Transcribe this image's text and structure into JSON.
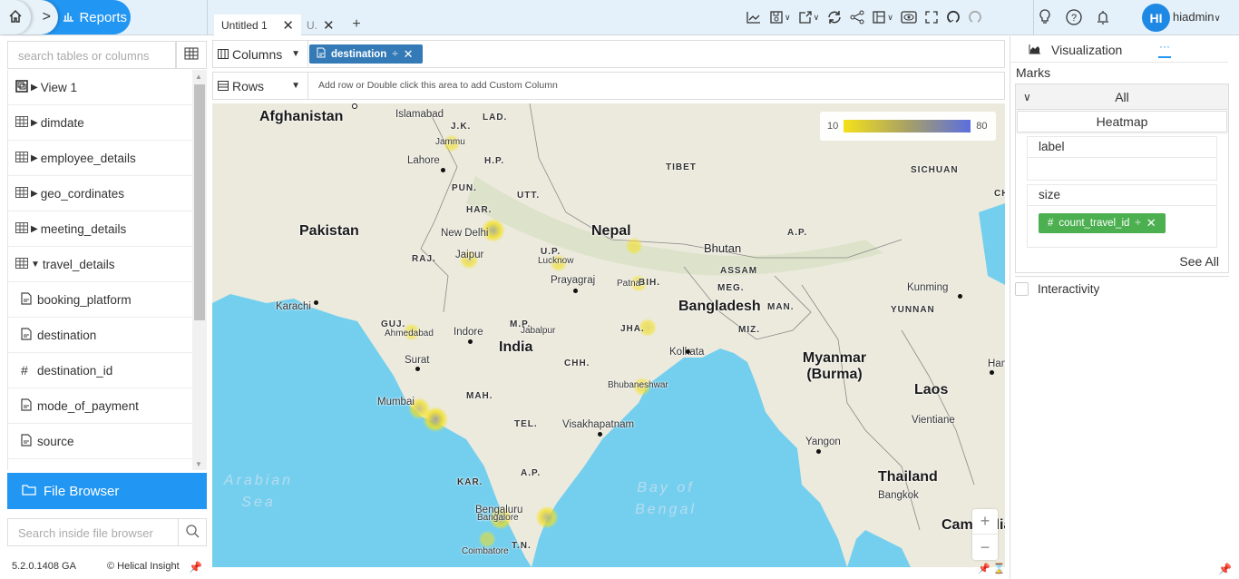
{
  "nav": {
    "reports_label": "Reports"
  },
  "tabs": [
    {
      "label": "Untitled 1"
    },
    {
      "label": "U."
    }
  ],
  "toolbar": {
    "icons": [
      "line-chart-icon",
      "save-icon",
      "export-icon",
      "refresh-icon",
      "share-icon",
      "layout-icon",
      "preview-icon",
      "fullscreen-icon",
      "undo-icon",
      "redo-icon"
    ]
  },
  "user": {
    "initials": "HI",
    "name": "hiadmin"
  },
  "sidebar": {
    "search_placeholder": "search tables or columns",
    "tables": [
      {
        "label": "View 1",
        "type": "view",
        "expanded": false
      },
      {
        "label": "dimdate",
        "type": "table",
        "expanded": false
      },
      {
        "label": "employee_details",
        "type": "table",
        "expanded": false
      },
      {
        "label": "geo_cordinates",
        "type": "table",
        "expanded": false
      },
      {
        "label": "meeting_details",
        "type": "table",
        "expanded": false
      },
      {
        "label": "travel_details",
        "type": "table",
        "expanded": true
      }
    ],
    "columns": [
      {
        "label": "booking_platform",
        "type": "text"
      },
      {
        "label": "destination",
        "type": "text"
      },
      {
        "label": "destination_id",
        "type": "number"
      },
      {
        "label": "mode_of_payment",
        "type": "text"
      },
      {
        "label": "source",
        "type": "text"
      }
    ],
    "file_browser_label": "File Browser",
    "file_search_placeholder": "Search inside file browser",
    "version": "5.2.0.1408 GA",
    "copyright": "Helical Insight"
  },
  "shelves": {
    "columns_label": "Columns",
    "columns_pill": "destination",
    "rows_label": "Rows",
    "rows_hint": "Add row or Double click this area to add Custom Column"
  },
  "map": {
    "legend_min": "10",
    "legend_max": "80",
    "legend_colors": {
      "low": "#f4e11a",
      "high": "#5b6ee0"
    },
    "countries": [
      "Afghanistan",
      "Pakistan",
      "India",
      "Nepal",
      "Bhutan",
      "Bangladesh",
      "Myanmar (Burma)",
      "Laos",
      "Thailand",
      "Cambodia"
    ],
    "regions": [
      "LAD.",
      "J.K.",
      "H.P.",
      "PUN.",
      "UTT.",
      "HAR.",
      "RAJ.",
      "U.P.",
      "BIH.",
      "GUJ.",
      "M.P.",
      "JHA.",
      "MAH.",
      "CHH.",
      "TEL.",
      "A.P.",
      "KAR.",
      "T.N.",
      "TIBET",
      "SICHUAN",
      "YUNNAN",
      "ASSAM",
      "MEG.",
      "MAN.",
      "MIZ.",
      "A.P.",
      "CH"
    ],
    "cities": [
      "Islamabad",
      "Jammu",
      "Lahore",
      "New Delhi",
      "Jaipur",
      "Lucknow",
      "Prayagraj",
      "Patna",
      "Karachi",
      "Ahmedabad",
      "Indore",
      "Jabalpur",
      "Kolkata",
      "Surat",
      "Mumbai",
      "Bhubaneshwar",
      "Visakhapatnam",
      "Bengaluru",
      "Bangalore",
      "Coimbatore",
      "Kunming",
      "Hanoi",
      "Vientiane",
      "Yangon",
      "Bangkok"
    ],
    "seas": [
      "Arabian Sea",
      "Bay of Bengal"
    ],
    "heat_points": [
      {
        "name": "Jammu",
        "level": 0.1
      },
      {
        "name": "New Delhi",
        "level": 0.6
      },
      {
        "name": "Jaipur",
        "level": 0.2
      },
      {
        "name": "Lucknow",
        "level": 0.1
      },
      {
        "name": "Nepal border",
        "level": 0.05
      },
      {
        "name": "Patna",
        "level": 0.05
      },
      {
        "name": "Ahmedabad",
        "level": 0.1
      },
      {
        "name": "Ranchi",
        "level": 0.15
      },
      {
        "name": "Bhubaneshwar",
        "level": 0.15
      },
      {
        "name": "Mumbai",
        "level": 0.4
      },
      {
        "name": "Pune",
        "level": 0.7
      },
      {
        "name": "Bangalore",
        "level": 0.5
      },
      {
        "name": "Chennai",
        "level": 0.5
      },
      {
        "name": "Coimbatore",
        "level": 0.05
      }
    ]
  },
  "panel": {
    "tab_label": "Visualization",
    "more_label": "···",
    "marks_label": "Marks",
    "all_label": "All",
    "heatmap_label": "Heatmap",
    "label_prop": "label",
    "size_prop": "size",
    "size_pill": "count_travel_id",
    "see_all": "See All",
    "interactivity_label": "Interactivity"
  }
}
